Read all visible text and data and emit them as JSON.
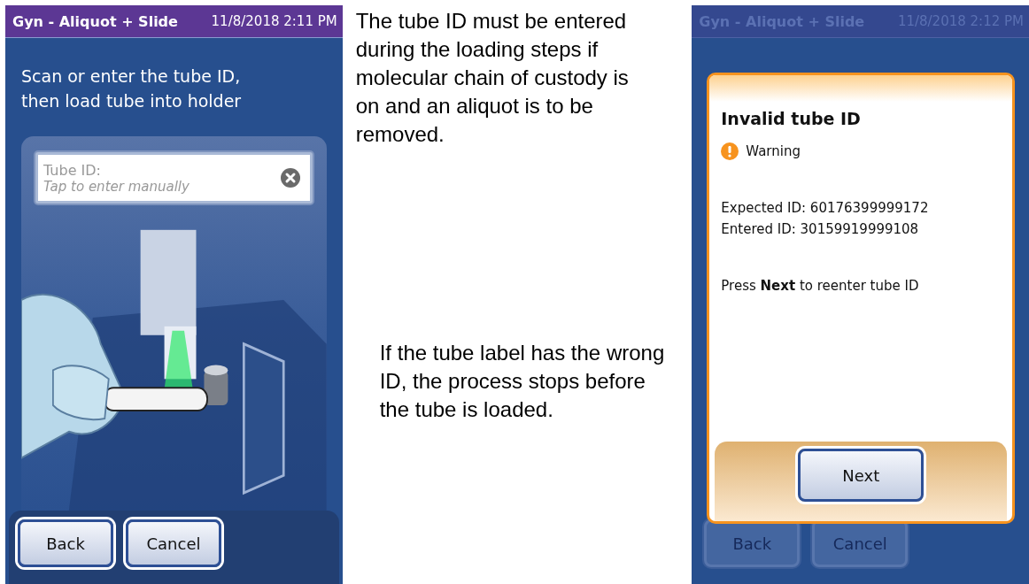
{
  "left_screen": {
    "title": "Gyn - Aliquot + Slide",
    "datetime": "11/8/2018 2:11 PM",
    "dimmed": false,
    "instruction": "Scan or enter the tube ID, then load tube into holder",
    "field": {
      "label": "Tube ID:",
      "placeholder": "Tap to enter manually"
    },
    "buttons": [
      {
        "label": "Back",
        "disabled": false
      },
      {
        "label": "Cancel",
        "disabled": false
      }
    ]
  },
  "captions": [
    "The tube ID must be entered during the loading steps if molecular chain of custody is on and an aliquot is to be removed.",
    "If the tube label has the wrong ID, the process stops before the tube is loaded."
  ],
  "right_screen": {
    "title": "Gyn - Aliquot + Slide",
    "datetime": "11/8/2018 2:12 PM",
    "dimmed": true,
    "dialog": {
      "title": "Invalid tube ID",
      "severity": "Warning",
      "lines": [
        "Expected ID: 60176399999172",
        "Entered ID: 30159919999108"
      ],
      "message": "Press **Next** to reenter tube ID",
      "button": "Next"
    },
    "buttons": [
      {
        "label": "Back",
        "disabled": true
      },
      {
        "label": "Cancel",
        "disabled": true
      }
    ]
  }
}
